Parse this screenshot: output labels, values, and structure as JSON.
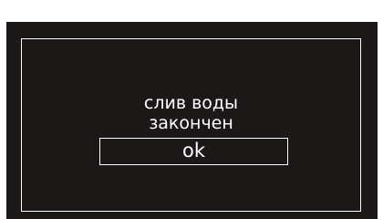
{
  "dialog": {
    "message_line1": "слив воды",
    "message_line2": "закончен",
    "ok_label": "ok"
  },
  "colors": {
    "background": "#1c1818",
    "foreground": "#ffffff"
  }
}
